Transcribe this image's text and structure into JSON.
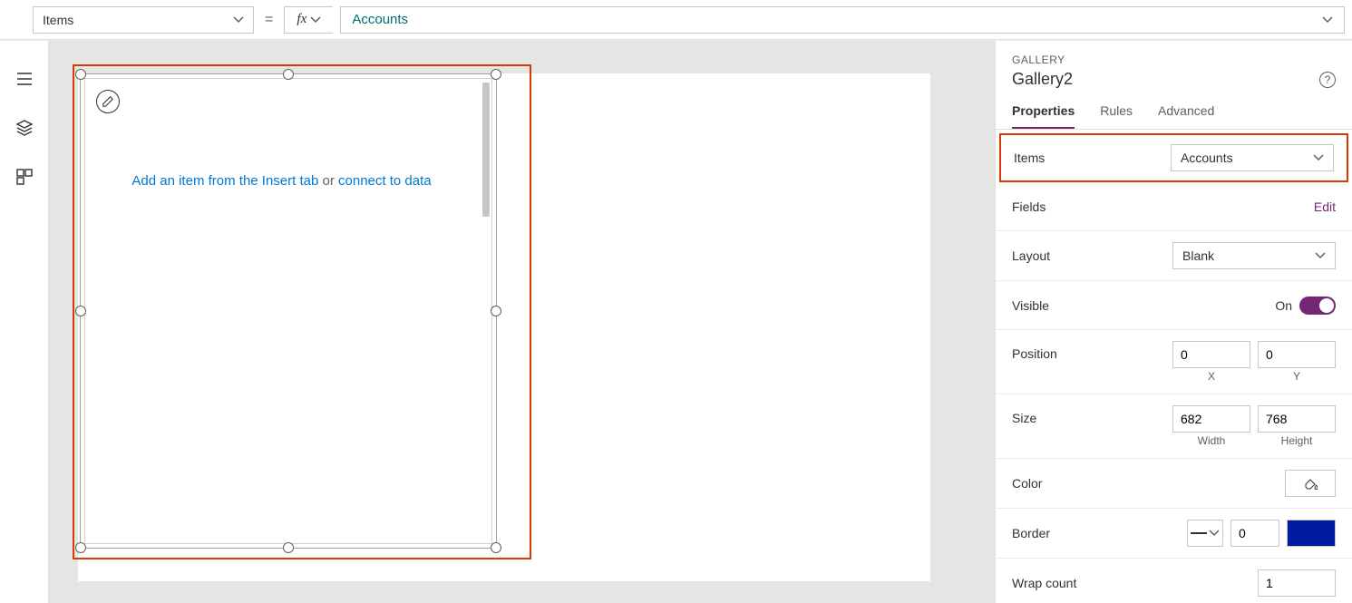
{
  "formulaBar": {
    "propertyName": "Items",
    "fxLabel": "fx",
    "formulaValue": "Accounts"
  },
  "canvas": {
    "placeholder_prefix": "Add an item from the Insert tab",
    "placeholder_middle": " or ",
    "placeholder_link": "connect to data"
  },
  "panel": {
    "typeLabel": "GALLERY",
    "controlName": "Gallery2",
    "helpGlyph": "?",
    "tabs": {
      "properties": "Properties",
      "rules": "Rules",
      "advanced": "Advanced"
    },
    "items": {
      "label": "Items",
      "value": "Accounts"
    },
    "fields": {
      "label": "Fields",
      "editLink": "Edit"
    },
    "layout": {
      "label": "Layout",
      "value": "Blank"
    },
    "visible": {
      "label": "Visible",
      "stateText": "On"
    },
    "position": {
      "label": "Position",
      "x": "0",
      "y": "0",
      "xLabel": "X",
      "yLabel": "Y"
    },
    "size": {
      "label": "Size",
      "width": "682",
      "height": "768",
      "widthLabel": "Width",
      "heightLabel": "Height"
    },
    "color": {
      "label": "Color"
    },
    "border": {
      "label": "Border",
      "width": "0"
    },
    "wrapCount": {
      "label": "Wrap count",
      "value": "1"
    }
  }
}
